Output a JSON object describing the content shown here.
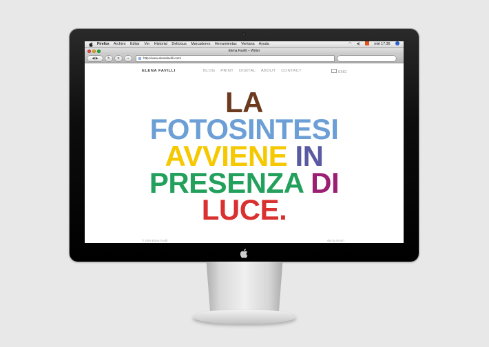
{
  "menubar": {
    "items": [
      "Firefox",
      "Archivo",
      "Editar",
      "Ver",
      "Historial",
      "Delicious",
      "Marcadores",
      "Herramientas",
      "Ventana",
      "Ayuda"
    ],
    "clock": "mié 17:36"
  },
  "window": {
    "title": "Elena Favilli – Writer"
  },
  "toolbar": {
    "url": "http://www.elenafavilli.com/"
  },
  "site": {
    "name": "ELENA FAVILLI",
    "nav": [
      "BLOG",
      "PRINT",
      "DIGITAL",
      "ABOUT",
      "CONTACT"
    ],
    "lang": "ENG"
  },
  "headline": {
    "lines": [
      [
        {
          "text": "LA",
          "color": "#6b3a1f"
        }
      ],
      [
        {
          "text": "FOTOSINTESI",
          "color": "#6c9fd6"
        }
      ],
      [
        {
          "text": "AVVIENE",
          "color": "#f5c800"
        },
        {
          "text": "IN",
          "color": "#5a5aa3"
        }
      ],
      [
        {
          "text": "PRESENZA",
          "color": "#22a05c"
        },
        {
          "text": "DI",
          "color": "#9b1f72"
        }
      ],
      [
        {
          "text": "LUCE.",
          "color": "#d93030"
        }
      ]
    ]
  },
  "footer": {
    "copyright": "© 2009 Elena Favilli",
    "credit": "site by Norah"
  }
}
